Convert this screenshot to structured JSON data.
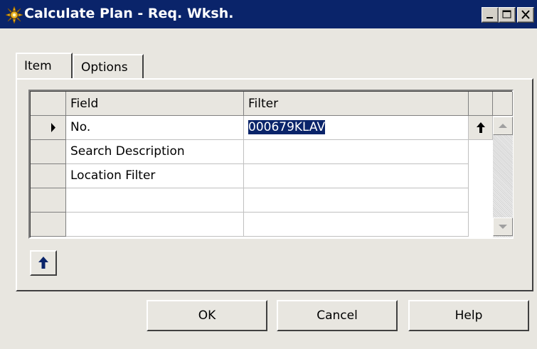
{
  "window": {
    "title": "Calculate Plan - Req. Wksh."
  },
  "tabs": [
    {
      "label": "Item"
    },
    {
      "label": "Options"
    }
  ],
  "grid": {
    "columns": [
      "Field",
      "Filter"
    ],
    "rows": [
      {
        "field": "No.",
        "filter": "000679KLAV",
        "current": true
      },
      {
        "field": "Search Description",
        "filter": ""
      },
      {
        "field": "Location Filter",
        "filter": ""
      },
      {
        "field": "",
        "filter": ""
      },
      {
        "field": "",
        "filter": ""
      }
    ]
  },
  "buttons": {
    "ok": "OK",
    "cancel": "Cancel",
    "help": "Help"
  },
  "colors": {
    "titlebar": "#0a246a",
    "selection": "#0a246a",
    "face": "#e8e6e0"
  }
}
